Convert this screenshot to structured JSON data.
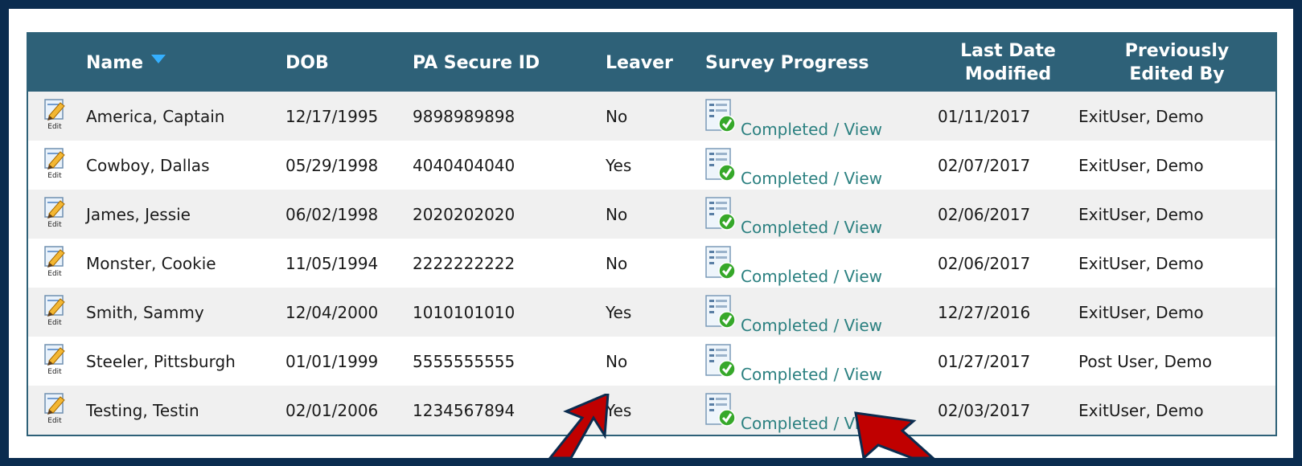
{
  "table": {
    "headers": {
      "name": "Name",
      "dob": "DOB",
      "pa_secure_id": "PA Secure ID",
      "leaver": "Leaver",
      "survey_progress": "Survey Progress",
      "last_date_modified_line1": "Last Date",
      "last_date_modified_line2": "Modified",
      "previously_edited_by_line1": "Previously",
      "previously_edited_by_line2": "Edited By"
    },
    "sort": {
      "column": "Name",
      "direction": "descending-arrow-icon"
    },
    "edit_label": "Edit",
    "rows": [
      {
        "name": "America, Captain",
        "dob": "12/17/1995",
        "pa_secure_id": "9898989898",
        "leaver": "No",
        "survey": "Completed / View",
        "last_modified": "01/11/2017",
        "edited_by": "ExitUser, Demo"
      },
      {
        "name": "Cowboy, Dallas",
        "dob": "05/29/1998",
        "pa_secure_id": "4040404040",
        "leaver": "Yes",
        "survey": "Completed / View",
        "last_modified": "02/07/2017",
        "edited_by": "ExitUser, Demo"
      },
      {
        "name": "James, Jessie",
        "dob": "06/02/1998",
        "pa_secure_id": "2020202020",
        "leaver": "No",
        "survey": "Completed / View",
        "last_modified": "02/06/2017",
        "edited_by": "ExitUser, Demo"
      },
      {
        "name": "Monster, Cookie",
        "dob": "11/05/1994",
        "pa_secure_id": "2222222222",
        "leaver": "No",
        "survey": "Completed / View",
        "last_modified": "02/06/2017",
        "edited_by": "ExitUser, Demo"
      },
      {
        "name": "Smith, Sammy",
        "dob": "12/04/2000",
        "pa_secure_id": "1010101010",
        "leaver": "Yes",
        "survey": "Completed / View",
        "last_modified": "12/27/2016",
        "edited_by": "ExitUser, Demo"
      },
      {
        "name": "Steeler, Pittsburgh",
        "dob": "01/01/1999",
        "pa_secure_id": "5555555555",
        "leaver": "No",
        "survey": "Completed / View",
        "last_modified": "01/27/2017",
        "edited_by": "Post User, Demo"
      },
      {
        "name": "Testing, Testin",
        "dob": "02/01/2006",
        "pa_secure_id": "1234567894",
        "leaver": "Yes",
        "survey": "Completed / View",
        "last_modified": "02/03/2017",
        "edited_by": "ExitUser, Demo"
      }
    ]
  },
  "colors": {
    "header_bg": "#2e6178",
    "frame_bg": "#0b2c4f",
    "link": "#2b8080",
    "annotation_arrow": "#c00000"
  },
  "icons": [
    "edit-pencil-icon",
    "survey-check-icon",
    "sort-arrow-icon",
    "annotation-arrow"
  ]
}
